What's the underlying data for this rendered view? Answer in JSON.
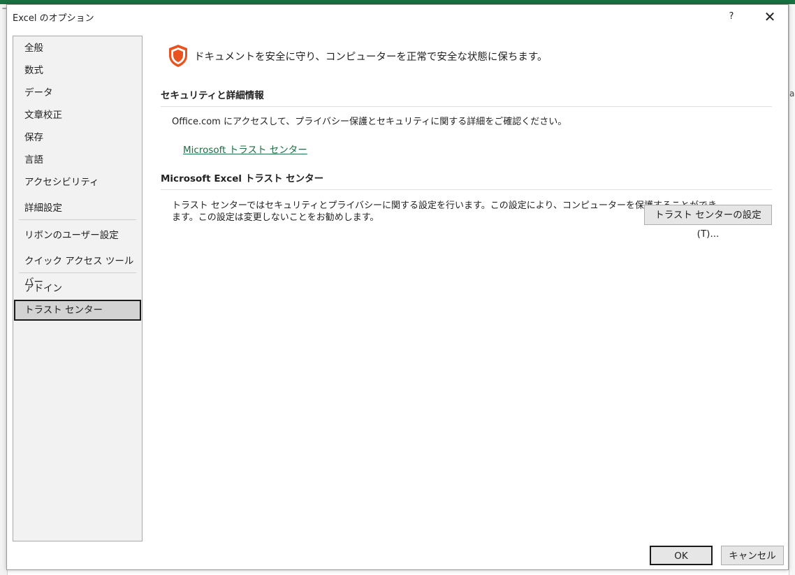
{
  "background": {
    "left_glyph_1": "ヿ",
    "right_glyph_1": "a"
  },
  "dialog": {
    "title": "Excel のオプション",
    "help": "?",
    "close": "✕"
  },
  "sidebar": {
    "items": [
      {
        "label": "全般"
      },
      {
        "label": "数式"
      },
      {
        "label": "データ"
      },
      {
        "label": "文章校正"
      },
      {
        "label": "保存"
      },
      {
        "label": "言語"
      },
      {
        "label": "アクセシビリティ"
      },
      {
        "label": "詳細設定"
      },
      {
        "label": "リボンのユーザー設定"
      },
      {
        "label": "クイック アクセス ツール バー"
      },
      {
        "label": "アドイン"
      },
      {
        "label": "トラスト センター",
        "selected": true
      }
    ]
  },
  "main": {
    "headline": "ドキュメントを安全に守り、コンピューターを正常で安全な状態に保ちます。",
    "security": {
      "title": "セキュリティと詳細情報",
      "description": "Office.com にアクセスして、プライバシー保護とセキュリティに関する詳細をご確認ください。",
      "link": "Microsoft トラスト センター"
    },
    "trust_center": {
      "title": "Microsoft Excel トラスト センター",
      "description_line1": "トラスト センターではセキュリティとプライバシーに関する設定を行います。この設定により、コンピューターを保護することができ",
      "description_line2": "ます。この設定は変更しないことをお勧めします。",
      "button": "トラスト センターの設定(T)..."
    }
  },
  "footer": {
    "ok": "OK",
    "cancel": "キャンセル"
  },
  "colors": {
    "accent": "#1e6e43",
    "shield": "#e8531f"
  }
}
